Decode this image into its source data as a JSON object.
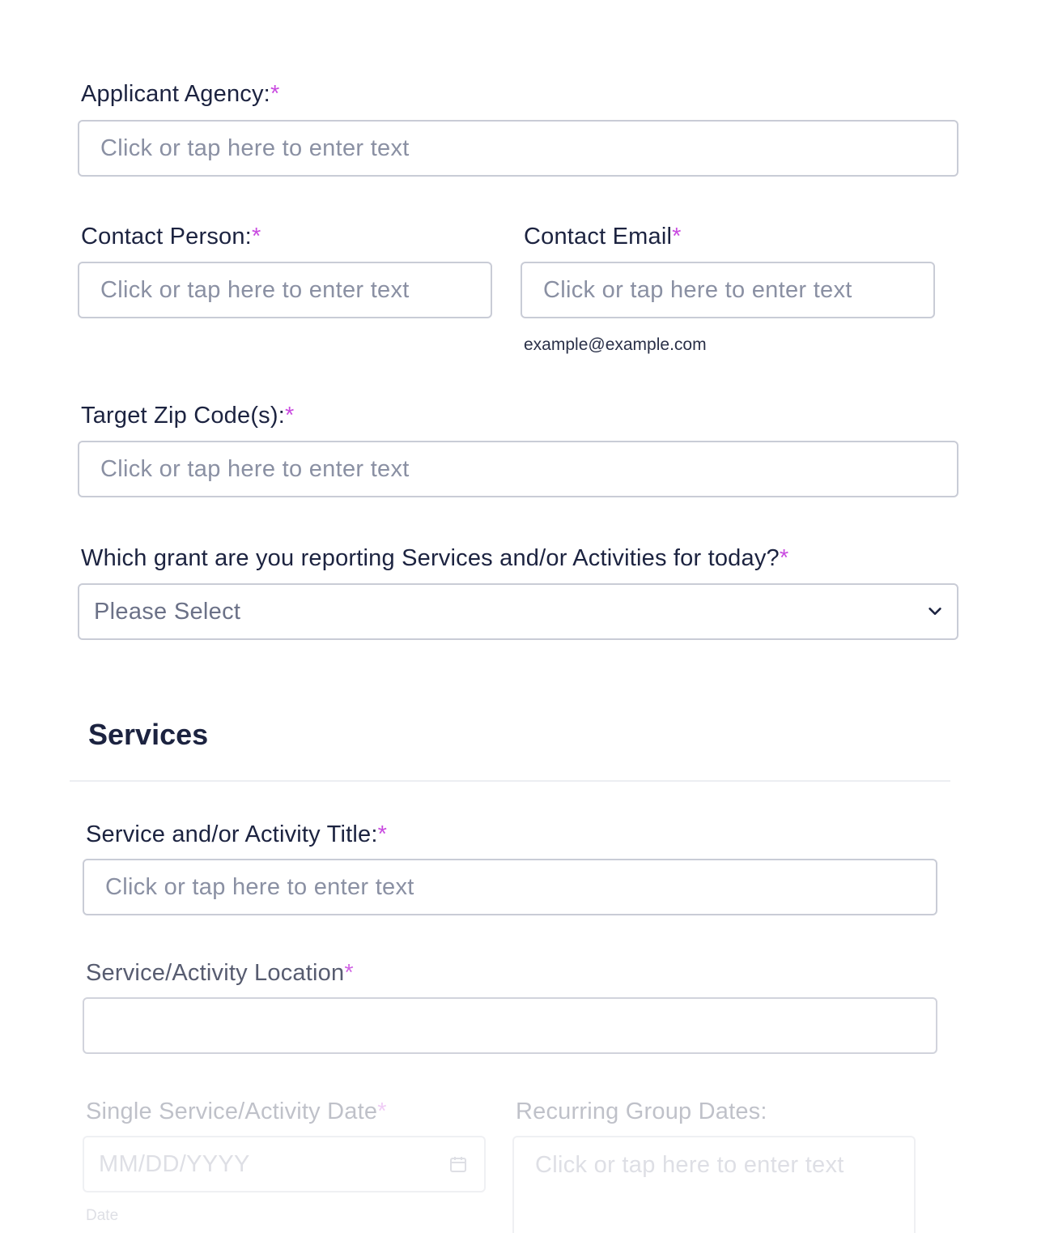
{
  "form": {
    "required_marker": "*",
    "applicant_agency": {
      "label": "Applicant Agency:",
      "placeholder": "Click or tap here to enter text"
    },
    "contact_person": {
      "label": "Contact Person:",
      "placeholder": "Click or tap here to enter text"
    },
    "contact_email": {
      "label": "Contact Email",
      "placeholder": "Click or tap here to enter text",
      "hint": "example@example.com"
    },
    "target_zip": {
      "label": "Target Zip Code(s):",
      "placeholder": "Click or tap here to enter text"
    },
    "grant_select": {
      "label": "Which grant are you reporting Services and/or Activities for today?",
      "selected": "Please Select"
    }
  },
  "services": {
    "title": "Services",
    "activity_title": {
      "label": "Service and/or Activity Title:",
      "placeholder": "Click or tap here to enter text"
    },
    "location": {
      "label": "Service/Activity Location",
      "placeholder": ""
    },
    "single_date": {
      "label": "Single Service/Activity Date",
      "placeholder": "MM/DD/YYYY",
      "hint": "Date"
    },
    "recurring_dates": {
      "label": "Recurring Group Dates:",
      "placeholder": "Click or tap here to enter text"
    }
  },
  "colors": {
    "required_accent": "#c94be0",
    "border": "#c9ccd6",
    "text": "#1c2340",
    "placeholder": "#8a90a3"
  },
  "icons": {
    "select_arrow": "chevron-down-icon",
    "date_picker": "calendar-icon"
  }
}
